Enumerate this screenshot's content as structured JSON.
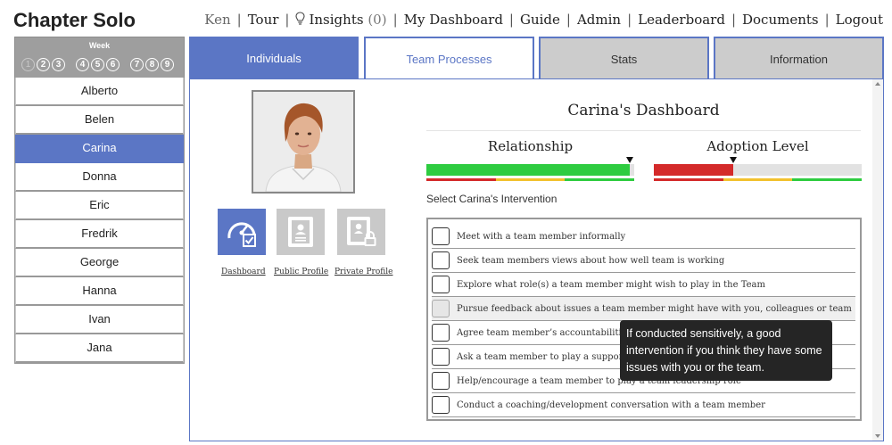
{
  "app": {
    "title": "Chapter Solo"
  },
  "topnav": {
    "user": "Ken",
    "tour": "Tour",
    "insights": "Insights",
    "insights_count": "(0)",
    "my_dashboard": "My Dashboard",
    "guide": "Guide",
    "admin": "Admin",
    "leaderboard": "Leaderboard",
    "documents": "Documents",
    "logout": "Logout",
    "separator": "|"
  },
  "week": {
    "label": "Week",
    "numbers": [
      "1",
      "2",
      "3",
      "4",
      "5",
      "6",
      "7",
      "8",
      "9"
    ],
    "completed": [
      "1"
    ]
  },
  "people": {
    "items": [
      "Alberto",
      "Belen",
      "Carina",
      "Donna",
      "Eric",
      "Fredrik",
      "George",
      "Hanna",
      "Ivan",
      "Jana"
    ],
    "selected": "Carina"
  },
  "tabs": {
    "individuals": "Individuals",
    "team_processes": "Team Processes",
    "stats": "Stats",
    "information": "Information"
  },
  "profile": {
    "dashboard_link": "Dashboard",
    "public_profile_link": "Public Profile",
    "private_profile_link": "Private Profile",
    "icons": [
      "dashboard-gauge-icon",
      "public-profile-card-icon",
      "private-profile-lock-icon"
    ]
  },
  "dashboard": {
    "title": "Carina's Dashboard",
    "relationship": {
      "label": "Relationship",
      "level": 0.98,
      "color": "#2ecc40"
    },
    "adoption": {
      "label": "Adoption Level",
      "level": 0.38,
      "color": "#d42a2a"
    },
    "scale_colors": [
      "#d42a2a",
      "#f2c12e",
      "#2ecc40"
    ],
    "select_label": "Select Carina's Intervention",
    "interventions": [
      "Meet with a team member informally",
      "Seek team members views about how well team is working",
      "Explore what role(s) a team member might wish to play in the Team",
      "Pursue feedback about issues a team member might have with you, colleagues or team",
      "Agree team member’s accountabilities",
      "Ask a team member to play a supporting role",
      "Help/encourage a team member to play a team leadership role",
      "Conduct a coaching/development conversation with a team member"
    ],
    "hovered_index": 3,
    "tooltip": "If conducted sensitively, a good intervention if you think they have some issues with you or the team."
  },
  "colors": {
    "accent": "#5b76c5",
    "tab_inactive": "#cccccc",
    "week_panel": "#9e9e9e"
  }
}
